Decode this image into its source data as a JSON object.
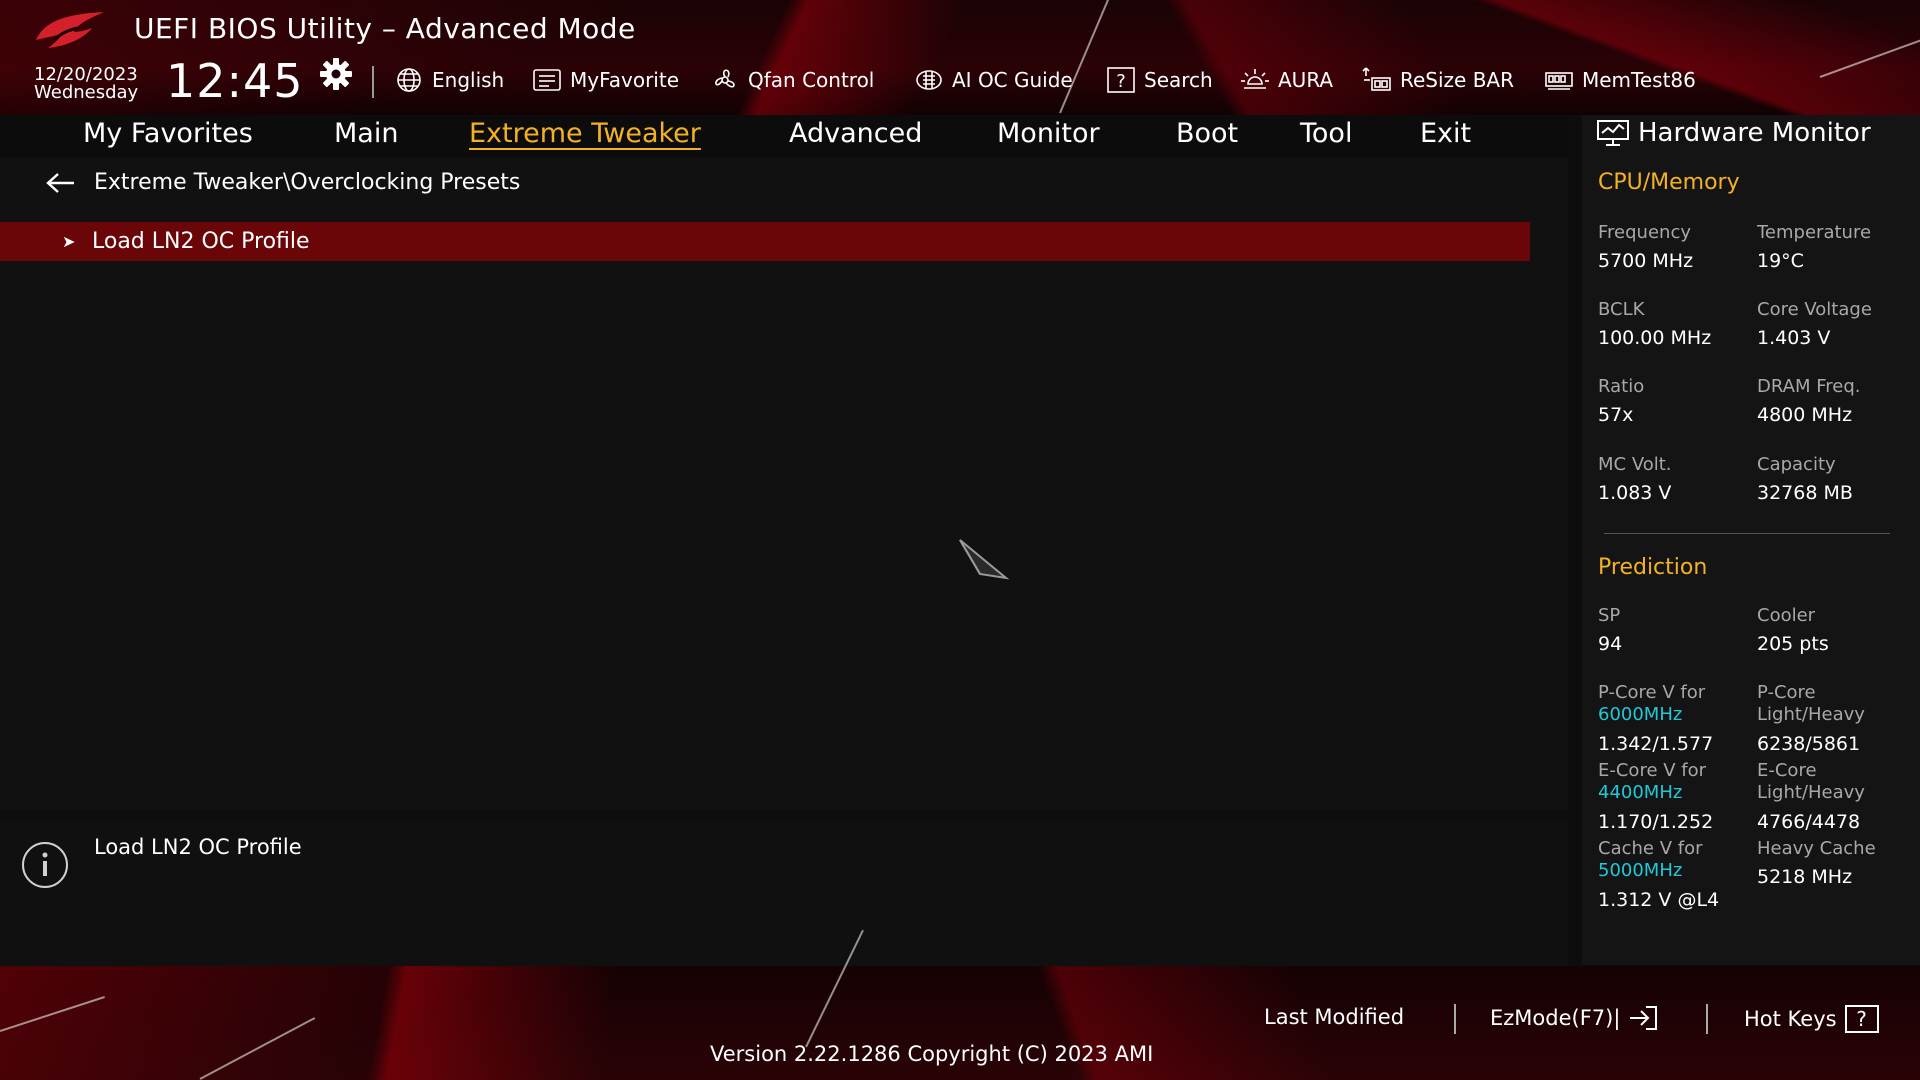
{
  "header": {
    "title": "UEFI BIOS Utility – Advanced Mode",
    "date": "12/20/2023",
    "day": "Wednesday",
    "time": "12:45"
  },
  "toolbar": [
    {
      "label": "English",
      "icon": "globe-icon"
    },
    {
      "label": "MyFavorite",
      "icon": "favorite-icon"
    },
    {
      "label": "Qfan Control",
      "icon": "fan-icon"
    },
    {
      "label": "AI OC Guide",
      "icon": "ai-chip-icon"
    },
    {
      "label": "Search",
      "icon": "question-box-icon"
    },
    {
      "label": "AURA",
      "icon": "aura-light-icon"
    },
    {
      "label": "ReSize BAR",
      "icon": "resize-bar-icon"
    },
    {
      "label": "MemTest86",
      "icon": "memory-module-icon"
    }
  ],
  "nav": {
    "tabs": [
      "My Favorites",
      "Main",
      "Extreme Tweaker",
      "Advanced",
      "Monitor",
      "Boot",
      "Tool",
      "Exit"
    ],
    "active": "Extreme Tweaker"
  },
  "breadcrumb": "Extreme Tweaker\\Overclocking Presets",
  "items": [
    {
      "label": "Load LN2 OC Profile",
      "selected": true
    }
  ],
  "help": {
    "text": "Load LN2 OC Profile"
  },
  "hardware_monitor": {
    "title": "Hardware Monitor",
    "cpu_memory": {
      "heading": "CPU/Memory",
      "frequency_label": "Frequency",
      "frequency": "5700 MHz",
      "temperature_label": "Temperature",
      "temperature": "19°C",
      "bclk_label": "BCLK",
      "bclk": "100.00 MHz",
      "core_voltage_label": "Core Voltage",
      "core_voltage": "1.403 V",
      "ratio_label": "Ratio",
      "ratio": "57x",
      "dram_freq_label": "DRAM Freq.",
      "dram_freq": "4800 MHz",
      "mc_volt_label": "MC Volt.",
      "mc_volt": "1.083 V",
      "capacity_label": "Capacity",
      "capacity": "32768 MB"
    },
    "prediction": {
      "heading": "Prediction",
      "sp_label": "SP",
      "sp": "94",
      "cooler_label": "Cooler",
      "cooler": "205 pts",
      "pcore_v_label": "P-Core V for",
      "pcore_v_freq": "6000MHz",
      "pcore_v": "1.342/1.577",
      "pcore_lh_label1": "P-Core",
      "pcore_lh_label2": "Light/Heavy",
      "pcore_lh": "6238/5861",
      "ecore_v_label": "E-Core V for",
      "ecore_v_freq": "4400MHz",
      "ecore_v": "1.170/1.252",
      "ecore_lh_label1": "E-Core",
      "ecore_lh_label2": "Light/Heavy",
      "ecore_lh": "4766/4478",
      "cache_v_label": "Cache V for",
      "cache_v_freq": "5000MHz",
      "cache_v": "1.312 V @L4",
      "heavy_cache_label": "Heavy Cache",
      "heavy_cache": "5218 MHz"
    }
  },
  "footer": {
    "last_modified": "Last Modified",
    "ezmode": "EzMode(F7)|",
    "hotkeys": "Hot Keys",
    "hotkeys_icon": "?",
    "version": "Version 2.22.1286 Copyright (C) 2023 AMI"
  },
  "colors": {
    "accent": "#f5b126",
    "selection": "#6b0608",
    "cyan": "#20c8d8"
  }
}
